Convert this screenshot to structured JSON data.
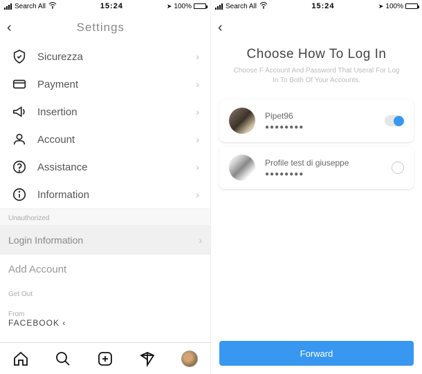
{
  "status": {
    "carrier": "Search All",
    "time": "15:24",
    "battery": "100%"
  },
  "left": {
    "title": "Settings",
    "items": [
      {
        "label": "Sicurezza"
      },
      {
        "label": "Payment"
      },
      {
        "label": "Insertion"
      },
      {
        "label": "Account"
      },
      {
        "label": "Assistance"
      },
      {
        "label": "Information"
      }
    ],
    "unauthorized": "Unauthorized",
    "login_info": "Login Information",
    "add_account": "Add Account",
    "get_out": "Get Out",
    "from_label": "From",
    "from_value": "FACEBOOK"
  },
  "right": {
    "title": "Choose How To Log In",
    "subtitle": "Choose F Account And Password That Useral For Log In To Both Of Your Accounts.",
    "accounts": [
      {
        "name": "Pipet96",
        "dots": "●●●●●●●●"
      },
      {
        "name": "Profile test di giuseppe",
        "dots": "●●●●●●●●"
      }
    ],
    "forward": "Forward"
  }
}
